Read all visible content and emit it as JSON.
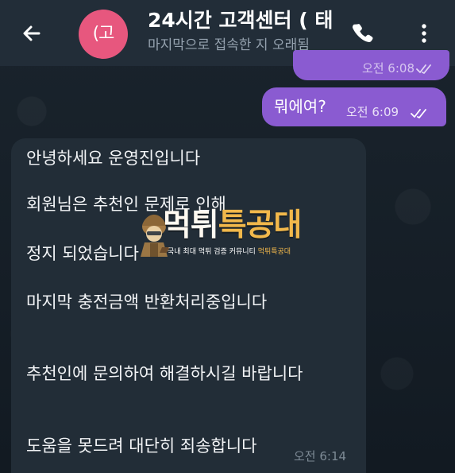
{
  "header": {
    "avatar_text": "(고",
    "title": "24시간 고객센터 ( 태",
    "subtitle": "마지막으로 접속한 지 오래됨",
    "icons": {
      "back": "arrow-left-icon",
      "call": "phone-icon",
      "menu": "more-vertical-icon"
    }
  },
  "chat": {
    "previous_time": "오전 6:08",
    "sent_message": {
      "text": "뭐에여?",
      "time": "오전 6:09"
    },
    "received_message": {
      "lines": [
        "안녕하세요 운영진입니다",
        "회원님은 추천인 문제로 인해",
        "정지 되었습니다",
        "마지막 충전금액 반환처리중입니다",
        "추천인에 문의하여 해결하시길 바랍니다",
        "도움을 못드려 대단히 죄송합니다"
      ],
      "time": "오전 6:14"
    }
  },
  "watermark": {
    "title_main": "먹튀",
    "title_accent": "특공대",
    "caption": "국내 최대 먹튀 검증 커뮤니티",
    "caption_accent": "먹튀특공대"
  },
  "colors": {
    "header": "#222d38",
    "background": "#121a22",
    "outgoing": "#8a5bd1",
    "incoming": "#222d37",
    "avatar": "#e7577e"
  }
}
